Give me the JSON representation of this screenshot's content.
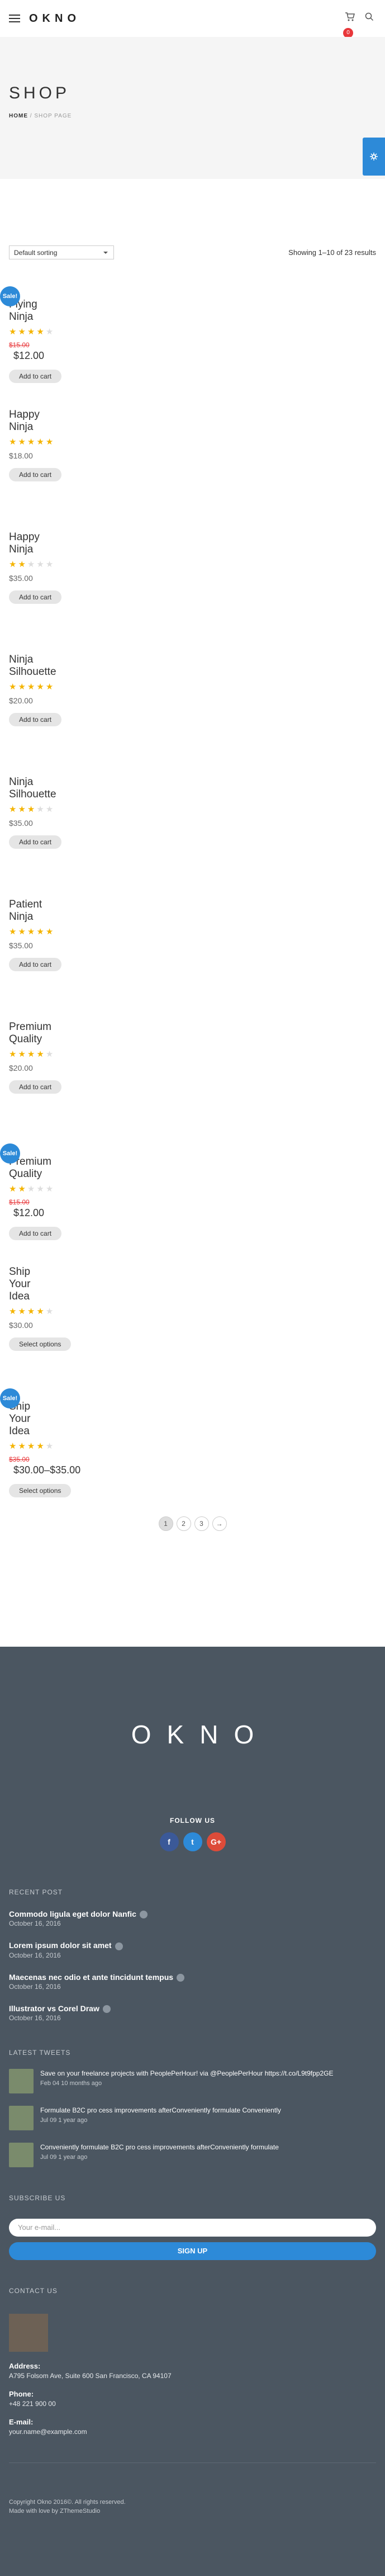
{
  "header": {
    "logo": "OKNO",
    "cart_count": "0"
  },
  "banner": {
    "title": "SHOP",
    "crumb_home": "HOME",
    "crumb_sep": "/",
    "crumb_current": "SHOP PAGE"
  },
  "shop": {
    "sort_label": "Default sorting",
    "result_count": "Showing 1–10 of 23 results"
  },
  "products": [
    {
      "name": "Flying Ninja",
      "sale": "Sale!",
      "rating": 4,
      "old_price": "$15.00",
      "price": "$12.00",
      "button": "Add to cart"
    },
    {
      "name": "Happy Ninja",
      "rating": 5,
      "price": "$18.00",
      "button": "Add to cart"
    },
    {
      "name": "Happy Ninja",
      "rating": 2,
      "price": "$35.00",
      "button": "Add to cart"
    },
    {
      "name": "Ninja Silhouette",
      "rating": 5,
      "price": "$20.00",
      "button": "Add to cart"
    },
    {
      "name": "Ninja Silhouette",
      "rating": 3,
      "price": "$35.00",
      "button": "Add to cart"
    },
    {
      "name": "Patient Ninja",
      "rating": 4.5,
      "price": "$35.00",
      "button": "Add to cart"
    },
    {
      "name": "Premium Quality",
      "rating": 3.5,
      "price": "$20.00",
      "button": "Add to cart"
    },
    {
      "name": "Premium Quality",
      "sale": "Sale!",
      "rating": 2,
      "old_price": "$15.00",
      "price": "$12.00",
      "button": "Add to cart"
    },
    {
      "name": "Ship Your Idea",
      "rating": 4,
      "price": "$30.00",
      "button": "Select options"
    },
    {
      "name": "Ship Your Idea",
      "sale": "Sale!",
      "rating": 4,
      "old_price": "$35.00",
      "price": "$30.00–$35.00",
      "button": "Select options"
    }
  ],
  "pagination": [
    "1",
    "2",
    "3",
    "→"
  ],
  "footer": {
    "logo": "OKNO",
    "follow": "FOLLOW US",
    "socials": [
      {
        "icon": "facebook-icon",
        "glyph": "f",
        "color": "#3b5998"
      },
      {
        "icon": "twitter-icon",
        "glyph": "t",
        "color": "#2d8ad8"
      },
      {
        "icon": "google-plus-icon",
        "glyph": "G+",
        "color": "#dd4b39"
      }
    ],
    "recent_title": "RECENT POST",
    "posts": [
      {
        "title": "Commodo ligula eget dolor Nanfic",
        "date": "October 16, 2016"
      },
      {
        "title": "Lorem ipsum dolor sit amet",
        "date": "October 16, 2016"
      },
      {
        "title": "Maecenas nec odio et ante tincidunt tempus",
        "date": "October 16, 2016"
      },
      {
        "title": "Illustrator vs Corel Draw",
        "date": "October 16, 2016"
      }
    ],
    "tweets_title": "LATEST TWEETS",
    "tweets": [
      {
        "text": "Save on your freelance projects with PeoplePerHour! via @PeoplePerHour https://t.co/L9t9fpp2GE",
        "meta": "Feb 04 10 months ago"
      },
      {
        "text": "Formulate B2C pro cess improvements afterConveniently formulate Conveniently",
        "meta": "Jul 09 1 year ago"
      },
      {
        "text": "Conveniently formulate B2C pro cess improvements afterConveniently formulate",
        "meta": "Jul 09 1 year ago"
      }
    ],
    "subscribe_title": "SUBSCRIBE US",
    "email_placeholder": "Your e-mail...",
    "signup": "SIGN UP",
    "contact_title": "CONTACT US",
    "address_label": "Address:",
    "address": "A795 Folsom Ave, Suite 600 San Francisco, CA 94107",
    "phone_label": "Phone:",
    "phone": "+48 221 900 00",
    "email_label": "E-mail:",
    "email": "your.name@example.com",
    "copyright": "Copyright Okno 2016©. All rights reserved.",
    "credits": "Made with love by ZThemeStudio"
  }
}
